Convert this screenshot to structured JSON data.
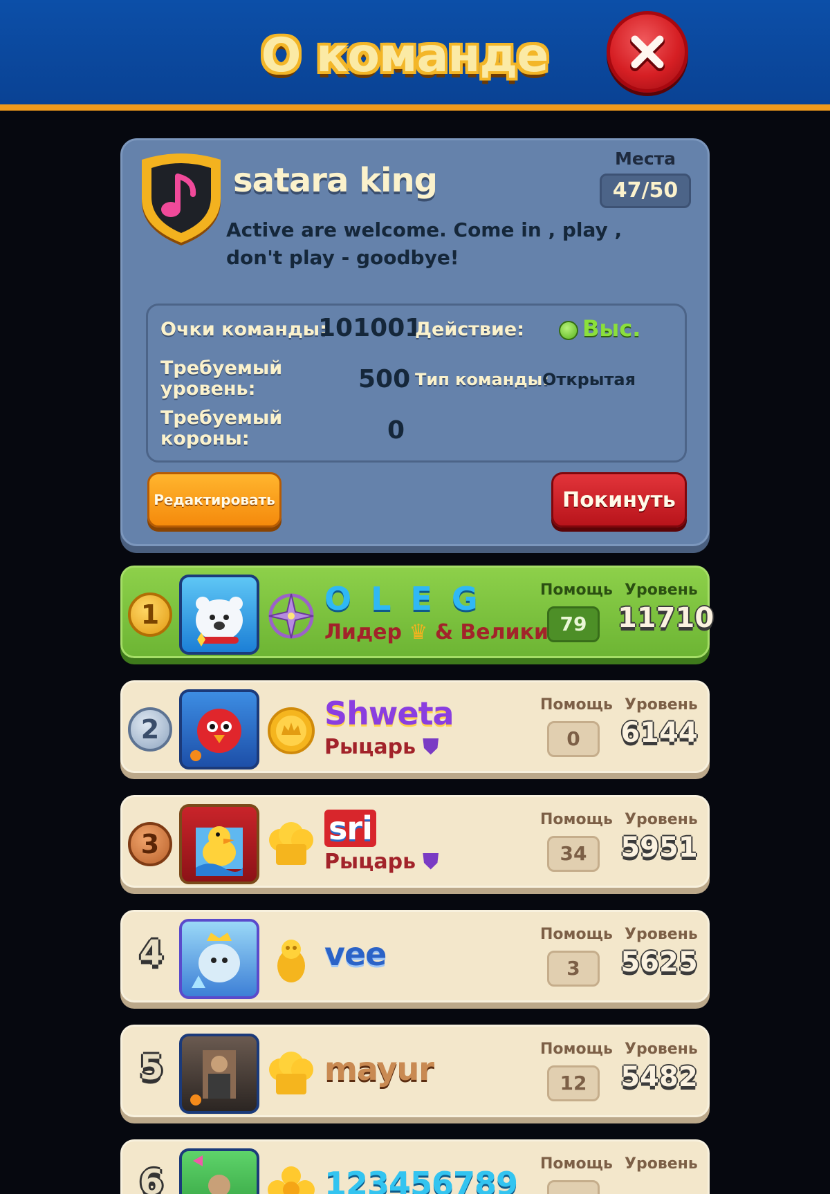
{
  "header": {
    "title": "О команде",
    "close_icon": "close-icon"
  },
  "team": {
    "name": "satara king",
    "emblem_icon": "music-note-shield-icon",
    "seats_label": "Места",
    "seats_value": "47/50",
    "description": "Active are welcome. Come in , play , don't play - goodbye!",
    "stats": {
      "score_label": "Очки команды:",
      "score_value": "101001",
      "activity_label": "Действие:",
      "activity_value": "Выс.",
      "required_level_label": "Требуемый уровень:",
      "required_level_value": "500",
      "team_type_label": "Тип команды:",
      "team_type_value": "Открытая",
      "required_crowns_label": "Требуемый короны:",
      "required_crowns_value": "0"
    },
    "edit_label": "Редактировать",
    "leave_label": "Покинуть"
  },
  "members": [
    {
      "rank": "1",
      "name": "O L E G",
      "role": "Лидер",
      "role_suffix": "& Велики",
      "help_label": "Помощь",
      "help": "79",
      "level_label": "Уровень",
      "level": "11710",
      "name_color": "#2fb8f5"
    },
    {
      "rank": "2",
      "name": "Shweta",
      "role": "Рыцарь",
      "help_label": "Помощь",
      "help": "0",
      "level_label": "Уровень",
      "level": "6144",
      "name_color": "#7b2fc9"
    },
    {
      "rank": "3",
      "name": "sri",
      "role": "Рыцарь",
      "help_label": "Помощь",
      "help": "34",
      "level_label": "Уровень",
      "level": "5951",
      "name_color": "#ffffff"
    },
    {
      "rank": "4",
      "name": "vee",
      "role": "",
      "help_label": "Помощь",
      "help": "3",
      "level_label": "Уровень",
      "level": "5625",
      "name_color": "#2b63c7"
    },
    {
      "rank": "5",
      "name": "mayur",
      "role": "",
      "help_label": "Помощь",
      "help": "12",
      "level_label": "Уровень",
      "level": "5482",
      "name_color": "#c98a52"
    },
    {
      "rank": "6",
      "name": "123456789",
      "role": "",
      "help_label": "Помощь",
      "help": "",
      "level_label": "Уровень",
      "level": "",
      "name_color": "#33c4f0"
    }
  ]
}
